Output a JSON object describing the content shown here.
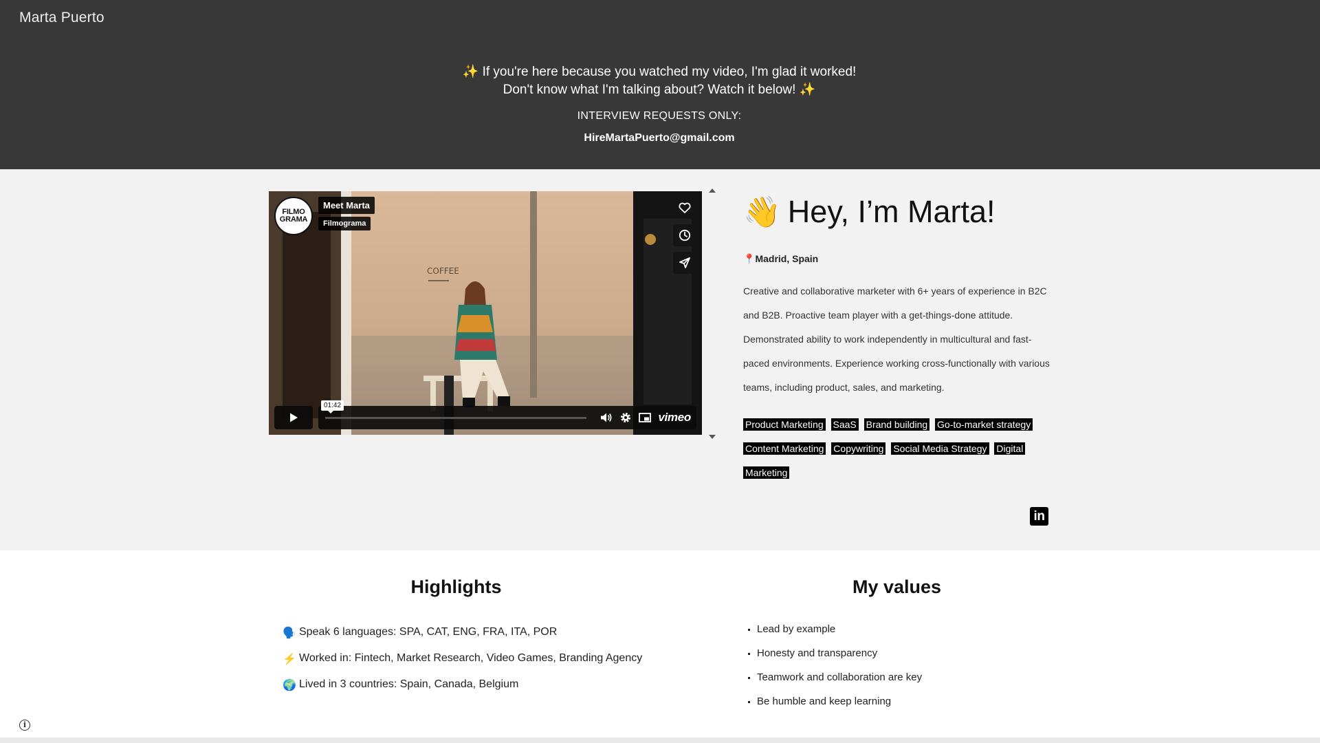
{
  "site": {
    "title": "Marta Puerto"
  },
  "banner": {
    "line1": "✨ If you're here because you watched my video, I'm glad it worked!",
    "line2": "Don't know what I'm talking about? Watch it below! ✨",
    "interview_label": "INTERVIEW REQUESTS ONLY:",
    "email": "HireMartaPuerto@gmail.com"
  },
  "video": {
    "logo_line1": "FILMO",
    "logo_line2": "GRAMA",
    "title": "Meet Marta",
    "channel": "Filmograma",
    "duration": "01:42",
    "player_brand": "vimeo",
    "side_icons": [
      "heart-icon",
      "clock-icon",
      "send-icon"
    ]
  },
  "intro": {
    "wave_emoji": "👋",
    "heading": "Hey, I’m Marta!",
    "location_pin": "📍",
    "location": "Madrid, Spain",
    "bio": "Creative and collaborative marketer with 6+ years of experience in B2C and B2B. Proactive team player with a get-things-done attitude. Demonstrated ability to work independently in multicultural and fast-paced environments. Experience working cross-functionally with various teams, including product, sales, and marketing.",
    "tags": [
      "Product Marketing",
      "SaaS",
      "Brand building",
      "Go-to-market strategy",
      "Content Marketing",
      "Copywriting",
      "Social Media Strategy",
      "Digital Marketing"
    ],
    "linkedin_label": "in"
  },
  "highlights": {
    "heading": "Highlights",
    "items": [
      {
        "emoji": "🗣️",
        "text": "Speak 6 languages: SPA, CAT, ENG, FRA, ITA, POR"
      },
      {
        "emoji": "⚡",
        "text": "Worked in: Fintech, Market Research, Video Games, Branding Agency"
      },
      {
        "emoji": "🌍",
        "text": "Lived in 3 countries: Spain, Canada, Belgium"
      }
    ]
  },
  "values": {
    "heading": "My values",
    "items": [
      "Lead by example",
      "Honesty and transparency",
      "Teamwork and collaboration are key",
      "Be humble and keep learning"
    ]
  },
  "footer": {
    "info_symbol": "i"
  },
  "colors": {
    "header_bg": "#383838",
    "section_bg": "#f2f2f2",
    "tag_bg": "#000000",
    "tag_text": "#ffffff"
  }
}
